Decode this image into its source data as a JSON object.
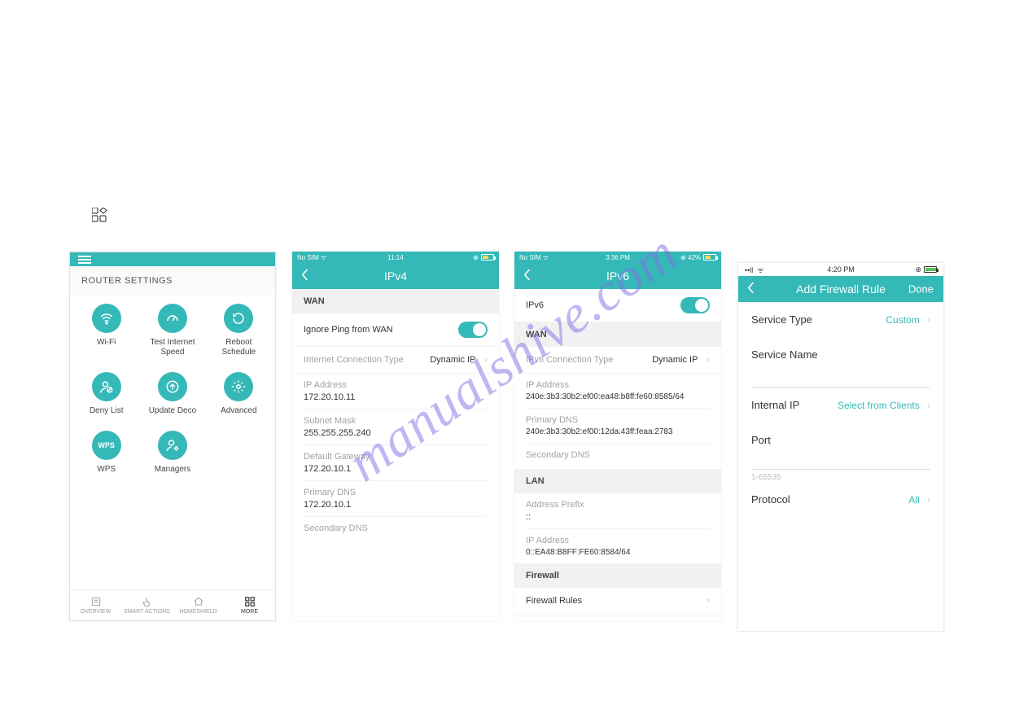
{
  "watermark": "manualshive.com",
  "top_icon_name": "grid-menu-icon",
  "screen1": {
    "section_title": "ROUTER SETTINGS",
    "items": [
      {
        "label": "Wi-Fi",
        "icon": "wifi-icon"
      },
      {
        "label": "Test Internet Speed",
        "icon": "speed-gauge-icon"
      },
      {
        "label": "Reboot Schedule",
        "icon": "reboot-icon"
      },
      {
        "label": "Deny List",
        "icon": "user-deny-icon"
      },
      {
        "label": "Update Deco",
        "icon": "upload-icon"
      },
      {
        "label": "Advanced",
        "icon": "gear-icon"
      },
      {
        "label": "WPS",
        "icon": "wps-icon",
        "text_icon": "WPS"
      },
      {
        "label": "Managers",
        "icon": "user-gear-icon"
      }
    ],
    "tabs": [
      {
        "label": "OVERVIEW",
        "icon": "list-icon"
      },
      {
        "label": "SMART ACTIONS",
        "icon": "tap-icon"
      },
      {
        "label": "HOMESHIELD",
        "icon": "home-shield-icon"
      },
      {
        "label": "MORE",
        "icon": "grid-icon",
        "active": true
      }
    ]
  },
  "screen2": {
    "status_left": "No SIM ᯤ",
    "status_center": "11:14",
    "status_right_pct": "",
    "title": "IPv4",
    "wan_header": "WAN",
    "ignore_ping_label": "Ignore Ping from WAN",
    "conn_type_label": "Internet Connection Type",
    "conn_type_value": "Dynamic IP",
    "fields": [
      {
        "label": "IP Address",
        "value": "172.20.10.11"
      },
      {
        "label": "Subnet Mask",
        "value": "255.255.255.240"
      },
      {
        "label": "Default Gateway",
        "value": "172.20.10.1"
      },
      {
        "label": "Primary DNS",
        "value": "172.20.10.1"
      },
      {
        "label": "Secondary DNS",
        "value": ""
      }
    ]
  },
  "screen3": {
    "status_left": "No SIM ᯤ",
    "status_center": "3:36 PM",
    "status_right_pct": "⊕ 42%",
    "title": "IPv6",
    "ipv6_toggle_label": "IPv6",
    "wan_header": "WAN",
    "conn_type_label": "IPv6 Connection Type",
    "conn_type_value": "Dynamic IP",
    "fields_wan": [
      {
        "label": "IP Address",
        "value": "240e:3b3:30b2:ef00:ea48:b8ff:fe60:8585/64"
      },
      {
        "label": "Primary DNS",
        "value": "240e:3b3:30b2:ef00:12da:43ff:feaa:2783"
      },
      {
        "label": "Secondary DNS",
        "value": ""
      }
    ],
    "lan_header": "LAN",
    "fields_lan": [
      {
        "label": "Address Prefix",
        "value": "::"
      },
      {
        "label": "IP Address",
        "value": "0::EA48:B8FF:FE60:8584/64"
      }
    ],
    "firewall_header": "Firewall",
    "firewall_rules_label": "Firewall Rules"
  },
  "screen4": {
    "status_center": "4:20 PM",
    "title": "Add Firewall Rule",
    "done_label": "Done",
    "service_type_label": "Service Type",
    "service_type_value": "Custom",
    "service_name_label": "Service Name",
    "internal_ip_label": "Internal IP",
    "internal_ip_value": "Select from Clients",
    "port_label": "Port",
    "port_hint": "1-65535",
    "protocol_label": "Protocol",
    "protocol_value": "All"
  }
}
